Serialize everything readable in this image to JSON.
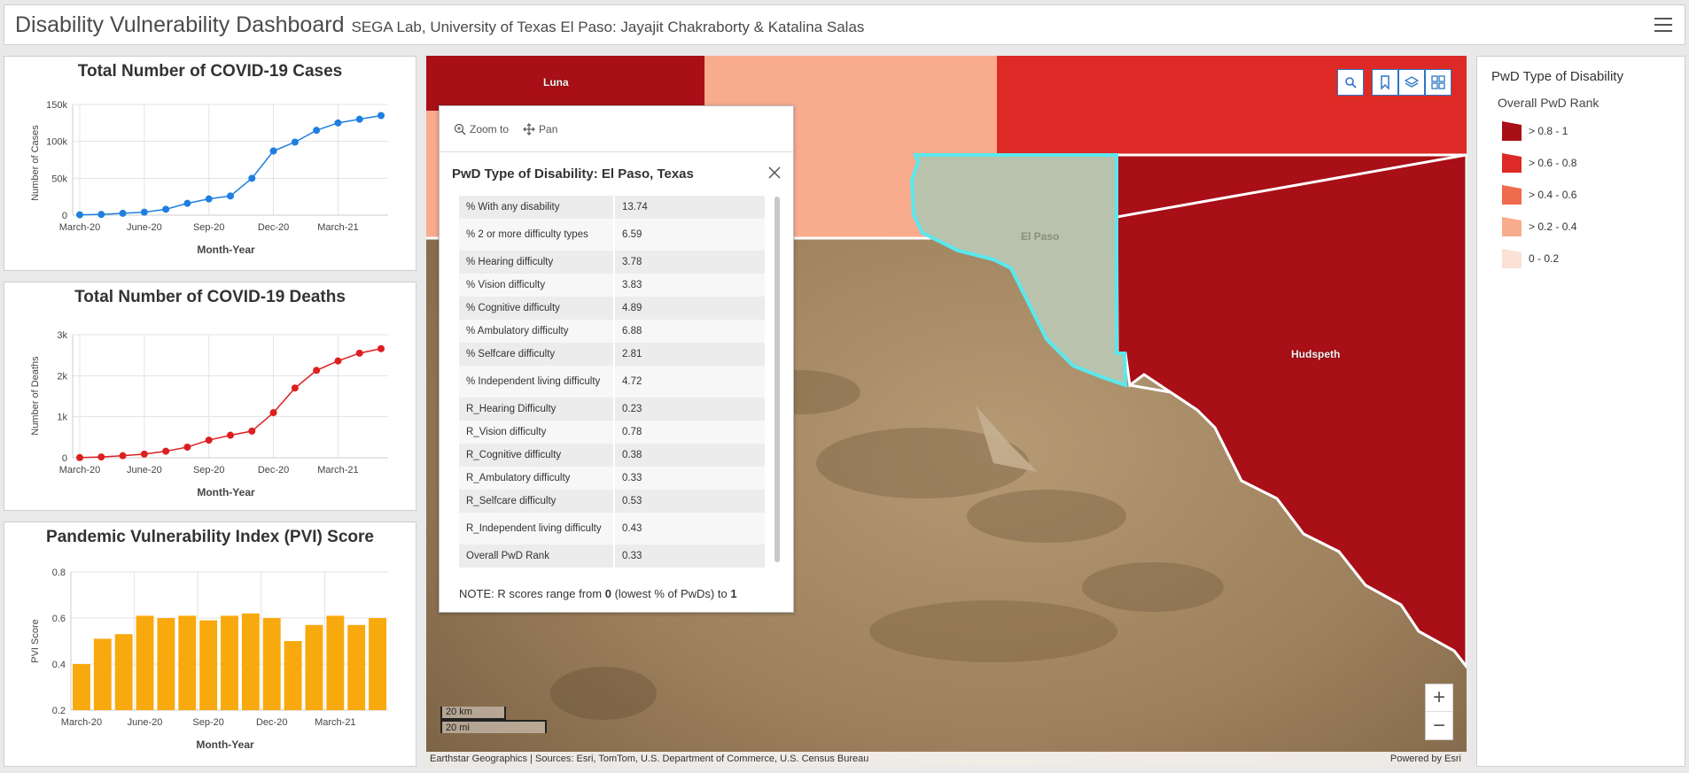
{
  "header": {
    "title": "Disability Vulnerability Dashboard",
    "subtitle": "SEGA Lab, University of Texas El Paso: Jayajit Chakraborty & Katalina Salas"
  },
  "colors": {
    "cases": "#1f7fe0",
    "deaths": "#dd1f1f",
    "pvi": "#f8a90e",
    "rank_08_1": "#a90f17",
    "rank_06_08": "#dd2a26",
    "rank_04_06": "#f06a4c",
    "rank_02_04": "#f9ab8e",
    "rank_0_02": "#fbe1d6",
    "selected_fill": "#b9c2ac",
    "selected_outline": "#5ae8ee"
  },
  "chart_data": [
    {
      "type": "line",
      "title": "Total Number of COVID-19 Cases",
      "xlabel": "Month-Year",
      "ylabel": "Number of Cases",
      "x": [
        "March-20",
        "April-20",
        "May-20",
        "June-20",
        "July-20",
        "August-20",
        "Sep-20",
        "Oct-20",
        "Nov-20",
        "Dec-20",
        "Jan-21",
        "Feb-21",
        "March-21",
        "April-21",
        "May-21"
      ],
      "x_ticks": [
        "March-20",
        "June-20",
        "Sep-20",
        "Dec-20",
        "March-21"
      ],
      "y_ticks": [
        "0",
        "50k",
        "100k",
        "150k"
      ],
      "ylim": [
        0,
        150000
      ],
      "values": [
        500,
        1000,
        2500,
        4000,
        8000,
        16000,
        22000,
        26000,
        50000,
        87000,
        99000,
        115000,
        125000,
        130000,
        135000
      ],
      "grid": true
    },
    {
      "type": "line",
      "title": "Total Number of COVID-19 Deaths",
      "xlabel": "Month-Year",
      "ylabel": "Number of Deaths",
      "x": [
        "March-20",
        "April-20",
        "May-20",
        "June-20",
        "July-20",
        "August-20",
        "Sep-20",
        "Oct-20",
        "Nov-20",
        "Dec-20",
        "Jan-21",
        "Feb-21",
        "March-21",
        "April-21",
        "May-21"
      ],
      "x_ticks": [
        "March-20",
        "June-20",
        "Sep-20",
        "Dec-20",
        "March-21"
      ],
      "y_ticks": [
        "0",
        "1k",
        "2k",
        "3k"
      ],
      "ylim": [
        0,
        3000
      ],
      "values": [
        5,
        20,
        50,
        90,
        160,
        260,
        430,
        550,
        650,
        1100,
        1700,
        2130,
        2360,
        2550,
        2660
      ],
      "grid": true
    },
    {
      "type": "bar",
      "title": "Pandemic Vulnerability Index (PVI) Score",
      "xlabel": "Month-Year",
      "ylabel": "PVI Score",
      "categories": [
        "March-20",
        "April-20",
        "May-20",
        "June-20",
        "July-20",
        "August-20",
        "Sep-20",
        "Oct-20",
        "Nov-20",
        "Dec-20",
        "Jan-21",
        "Feb-21",
        "March-21",
        "April-21",
        "May-21"
      ],
      "x_ticks": [
        "March-20",
        "June-20",
        "Sep-20",
        "Dec-20",
        "March-21"
      ],
      "y_ticks": [
        "0.2",
        "0.4",
        "0.6",
        "0.8"
      ],
      "ylim": [
        0.2,
        0.8
      ],
      "values": [
        0.4,
        0.51,
        0.53,
        0.61,
        0.6,
        0.61,
        0.59,
        0.61,
        0.62,
        0.6,
        0.5,
        0.57,
        0.61,
        0.57,
        0.6
      ],
      "grid": true
    }
  ],
  "map": {
    "county_labels": [
      "Luna",
      "El Paso",
      "Hudspeth"
    ],
    "actions": {
      "zoom_to": "Zoom to",
      "pan": "Pan"
    },
    "scalebar": {
      "km": "20 km",
      "mi": "20 mi"
    },
    "attribution": "Earthstar Geographics | Sources: Esri, TomTom, U.S. Department of Commerce, U.S. Census Bureau",
    "powered_by": "Powered by Esri",
    "toolbar_icons": [
      "search-icon",
      "bookmark-icon",
      "layers-icon",
      "basemap-gallery-icon"
    ]
  },
  "popup": {
    "title": "PwD Type of Disability: El Paso, Texas",
    "rows": [
      {
        "k": "% With any disability",
        "v": "13.74"
      },
      {
        "k": "% 2 or more difficulty types",
        "v": "6.59"
      },
      {
        "k": "% Hearing difficulty",
        "v": "3.78"
      },
      {
        "k": "% Vision difficulty",
        "v": "3.83"
      },
      {
        "k": "% Cognitive difficulty",
        "v": "4.89"
      },
      {
        "k": "% Ambulatory difficulty",
        "v": "6.88"
      },
      {
        "k": "% Selfcare difficulty",
        "v": "2.81"
      },
      {
        "k": "% Independent living difficulty",
        "v": "4.72"
      },
      {
        "k": "R_Hearing Difficulty",
        "v": "0.23"
      },
      {
        "k": "R_Vision difficulty",
        "v": "0.78"
      },
      {
        "k": "R_Cognitive difficulty",
        "v": "0.38"
      },
      {
        "k": "R_Ambulatory difficulty",
        "v": "0.33"
      },
      {
        "k": "R_Selfcare difficulty",
        "v": "0.53"
      },
      {
        "k": "R_Independent living difficulty",
        "v": "0.43"
      },
      {
        "k": "Overall PwD Rank",
        "v": "0.33"
      }
    ],
    "note_prefix": "NOTE: R scores range from ",
    "note_low": "0",
    "note_mid": " (lowest % of PwDs) to ",
    "note_high": "1"
  },
  "legend": {
    "title": "PwD Type of Disability",
    "subtitle": "Overall PwD Rank",
    "items": [
      {
        "label": "> 0.8 - 1",
        "color": "#a90f17"
      },
      {
        "label": "> 0.6 - 0.8",
        "color": "#dd2a26"
      },
      {
        "label": "> 0.4 - 0.6",
        "color": "#f06a4c"
      },
      {
        "label": "> 0.2 - 0.4",
        "color": "#f9ab8e"
      },
      {
        "label": "0 - 0.2",
        "color": "#fbe1d6"
      }
    ]
  }
}
